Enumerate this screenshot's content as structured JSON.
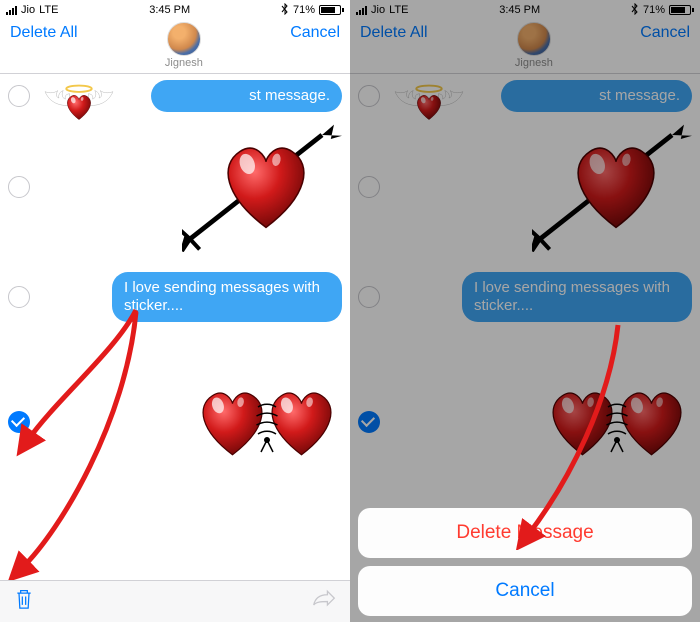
{
  "status": {
    "carrier": "Jio",
    "network": "LTE",
    "time": "3:45 PM",
    "battery_pct": "71%",
    "bluetooth": "\u0010"
  },
  "header": {
    "delete_all": "Delete All",
    "cancel": "Cancel",
    "contact_name": "Jignesh"
  },
  "messages": {
    "msg1_text": "st message.",
    "msg2_text": "I love sending messages with sticker....",
    "msg1_selected": false,
    "arrow_heart_selected": false,
    "msg2_selected": false,
    "laced_selected_left": true,
    "laced_selected_right": true
  },
  "stickers": {
    "winged_heart": "winged-heart-sticker",
    "arrow_heart": "heart-with-arrow-sticker",
    "laced_hearts": "two-hearts-laced-sticker"
  },
  "action_sheet": {
    "delete": "Delete Message",
    "cancel": "Cancel"
  },
  "colors": {
    "ios_blue": "#007aff",
    "bubble_blue": "#3fa6f4",
    "destructive_red": "#ff3b30"
  }
}
